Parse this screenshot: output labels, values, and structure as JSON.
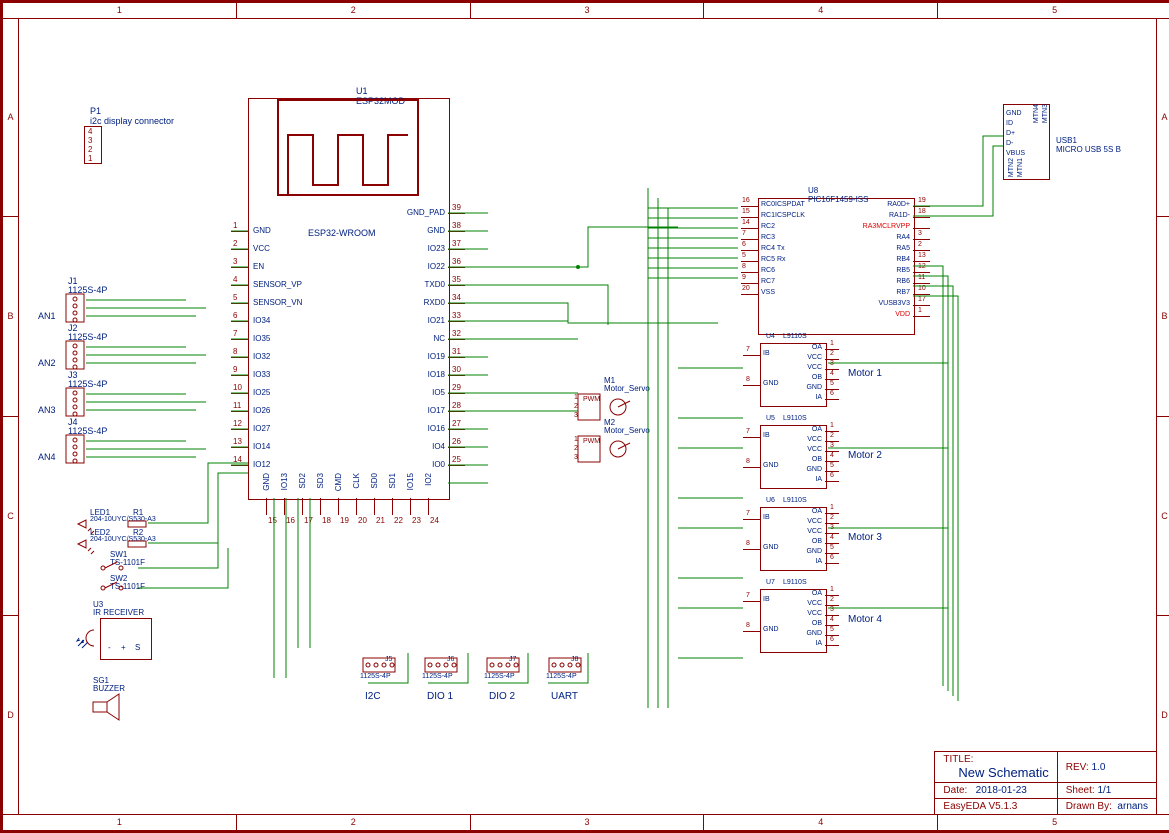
{
  "ruler_cols": [
    "1",
    "2",
    "3",
    "4",
    "5"
  ],
  "ruler_rows": [
    "A",
    "B",
    "C",
    "D"
  ],
  "p1": {
    "ref": "P1",
    "desc": "i2c display connector",
    "pins": [
      "4",
      "3",
      "2",
      "1"
    ]
  },
  "j1": {
    "ref": "J1",
    "val": "1125S-4P"
  },
  "j2": {
    "ref": "J2",
    "val": "1125S-4P"
  },
  "j3": {
    "ref": "J3",
    "val": "1125S-4P"
  },
  "j4": {
    "ref": "J4",
    "val": "1125S-4P"
  },
  "an": [
    "AN1",
    "AN2",
    "AN3",
    "AN4"
  ],
  "led1": {
    "ref": "LED1",
    "val": "204-10UYC/S530-A3"
  },
  "led2": {
    "ref": "LED2",
    "val": "204-10UYC/S530-A3"
  },
  "r1": {
    "ref": "R1"
  },
  "r2": {
    "ref": "R2"
  },
  "sw1": {
    "ref": "SW1",
    "val": "TS-1101F"
  },
  "sw2": {
    "ref": "SW2",
    "val": "TS-1101F"
  },
  "u3": {
    "ref": "U3",
    "val": "IR RECEIVER",
    "pins": [
      "-",
      "+",
      "S"
    ]
  },
  "sg1": {
    "ref": "SG1",
    "val": "BUZZER"
  },
  "u1": {
    "ref": "U1",
    "val": "ESP32MOD",
    "name": "ESP32-WROOM",
    "left": [
      [
        "1",
        "GND"
      ],
      [
        "2",
        "VCC"
      ],
      [
        "3",
        "EN"
      ],
      [
        "4",
        "SENSOR_VP"
      ],
      [
        "5",
        "SENSOR_VN"
      ],
      [
        "6",
        "IO34"
      ],
      [
        "7",
        "IO35"
      ],
      [
        "8",
        "IO32"
      ],
      [
        "9",
        "IO33"
      ],
      [
        "10",
        "IO25"
      ],
      [
        "11",
        "IO26"
      ],
      [
        "12",
        "IO27"
      ],
      [
        "13",
        "IO14"
      ],
      [
        "14",
        "IO12"
      ]
    ],
    "right": [
      [
        "39",
        "GND_PAD"
      ],
      [
        "38",
        "GND"
      ],
      [
        "37",
        "IO23"
      ],
      [
        "36",
        "IO22"
      ],
      [
        "35",
        "TXD0"
      ],
      [
        "34",
        "RXD0"
      ],
      [
        "33",
        "IO21"
      ],
      [
        "32",
        "NC"
      ],
      [
        "31",
        "IO19"
      ],
      [
        "30",
        "IO18"
      ],
      [
        "29",
        "IO5"
      ],
      [
        "28",
        "IO17"
      ],
      [
        "27",
        "IO16"
      ],
      [
        "26",
        "IO4"
      ],
      [
        "25",
        "IO0"
      ]
    ],
    "bottom": [
      [
        "15",
        "GND"
      ],
      [
        "16",
        "IO13"
      ],
      [
        "17",
        "SD2"
      ],
      [
        "18",
        "SD3"
      ],
      [
        "19",
        "CMD"
      ],
      [
        "20",
        "CLK"
      ],
      [
        "21",
        "SD0"
      ],
      [
        "22",
        "SD1"
      ],
      [
        "23",
        "IO15"
      ],
      [
        "24",
        "IO2"
      ]
    ]
  },
  "m1": {
    "ref": "M1",
    "val": "Motor_Servo",
    "pwm": "PWM",
    "pins": [
      "1",
      "2",
      "3"
    ]
  },
  "m2": {
    "ref": "M2",
    "val": "Motor_Servo",
    "pwm": "PWM",
    "pins": [
      "1",
      "2",
      "3"
    ]
  },
  "u8": {
    "ref": "U8",
    "val": "PIC16F1459-ISS",
    "left": [
      [
        "16",
        "RC0ICSPDAT"
      ],
      [
        "15",
        "RC1ICSPCLK"
      ],
      [
        "14",
        "RC2"
      ],
      [
        "7",
        "RC3"
      ],
      [
        "6",
        "RC4 Tx"
      ],
      [
        "5",
        "RC5 Rx"
      ],
      [
        "8",
        "RC6"
      ],
      [
        "9",
        "RC7"
      ],
      [
        "20",
        "VSS"
      ]
    ],
    "right": [
      [
        "19",
        "RA0D+"
      ],
      [
        "18",
        "RA1D-"
      ],
      [
        "",
        "RA3MCLRVPP"
      ],
      [
        "3",
        "RA4"
      ],
      [
        "2",
        "RA5"
      ],
      [
        "13",
        "RB4"
      ],
      [
        "12",
        "RB5"
      ],
      [
        "11",
        "RB6"
      ],
      [
        "10",
        "RB7"
      ],
      [
        "17",
        "VUSB3V3"
      ],
      [
        "1",
        "VDD"
      ]
    ]
  },
  "motor_drv": {
    "val": "L9110S",
    "left": [
      [
        "7",
        "IB"
      ],
      [
        "8",
        "GND"
      ]
    ],
    "right": [
      [
        "1",
        "OA"
      ],
      [
        "2",
        "VCC"
      ],
      [
        "3",
        "VCC"
      ],
      [
        "4",
        "OB"
      ],
      [
        "5",
        "GND"
      ],
      [
        "6",
        "IA"
      ]
    ]
  },
  "motors": [
    {
      "ref": "U4",
      "label": "Motor 1"
    },
    {
      "ref": "U5",
      "label": "Motor 2"
    },
    {
      "ref": "U6",
      "label": "Motor 3"
    },
    {
      "ref": "U7",
      "label": "Motor 4"
    }
  ],
  "usb": {
    "ref": "USB1",
    "val": "MICRO USB 5S B",
    "pins": [
      "GND",
      "ID",
      "D+",
      "D-",
      "VBUS"
    ],
    "mtn": [
      "MTN4",
      "MTN3",
      "MTN2",
      "MTN1"
    ]
  },
  "bottom_conn": [
    {
      "ref": "J5",
      "val": "1125S-4P",
      "label": "I2C"
    },
    {
      "ref": "J6",
      "val": "1125S-4P",
      "label": "DIO 1"
    },
    {
      "ref": "J7",
      "val": "1125S-4P",
      "label": "DIO 2"
    },
    {
      "ref": "J8",
      "val": "1125S-4P",
      "label": "UART"
    }
  ],
  "title": {
    "t": "TITLE:",
    "name": "New Schematic",
    "rev_l": "REV:",
    "rev": "1.0",
    "date_l": "Date:",
    "date": "2018-01-23",
    "sheet_l": "Sheet:",
    "sheet": "1/1",
    "sw": "EasyEDA V5.1.3",
    "drawn_l": "Drawn By:",
    "drawn": "arnans"
  }
}
